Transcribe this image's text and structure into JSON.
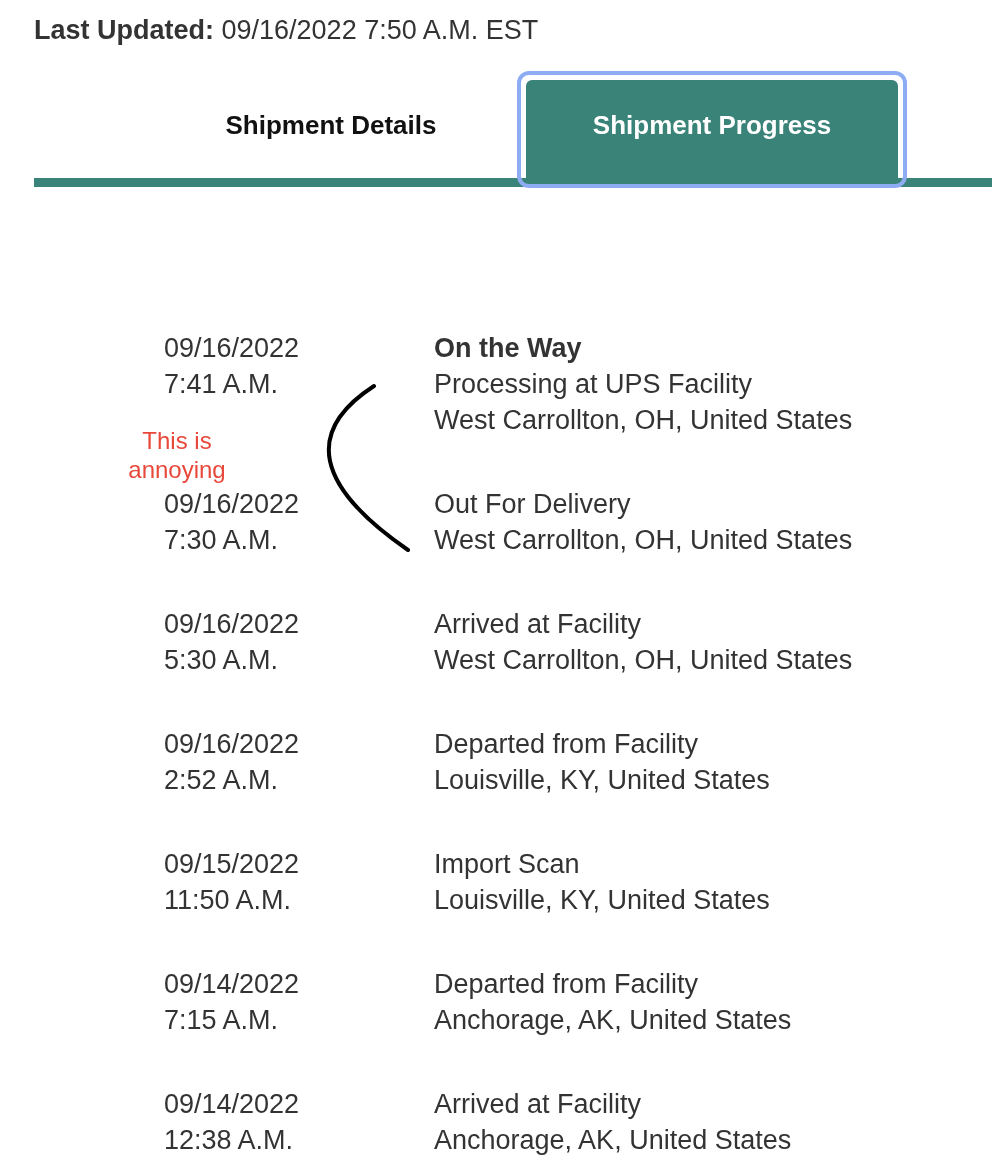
{
  "last_updated": "**Last Updated:** 09/16/2022 7:50 A.M. EST",
  "tabs": [
    {
      "label": "Shipment Details",
      "selected": false,
      "focused": false
    },
    {
      "label": "Shipment Progress",
      "selected": true,
      "focused": true
    }
  ],
  "events": [
    {
      "date": "09/16/2022",
      "time": "7:41 A.M.",
      "status": "On the Way",
      "activity": "Processing at UPS Facility",
      "location": "West Carrollton, OH, United States"
    },
    {
      "date": "09/16/2022",
      "time": "7:30 A.M.",
      "activity": "Out For Delivery",
      "location": "West Carrollton, OH, United States"
    },
    {
      "date": "09/16/2022",
      "time": "5:30 A.M.",
      "activity": "Arrived at Facility",
      "location": "West Carrollton, OH, United States"
    },
    {
      "date": "09/16/2022",
      "time": "2:52 A.M.",
      "activity": "Departed from Facility",
      "location": "Louisville, KY, United States"
    },
    {
      "date": "09/15/2022",
      "time": "11:50 A.M.",
      "activity": "Import Scan",
      "location": "Louisville, KY, United States"
    },
    {
      "date": "09/14/2022",
      "time": "7:15 A.M.",
      "activity": "Departed from Facility",
      "location": "Anchorage, AK, United States"
    },
    {
      "date": "09/14/2022",
      "time": "12:38 A.M.",
      "activity": "Arrived at Facility",
      "location": "Anchorage, AK, United States"
    }
  ],
  "annotation": {
    "text": "This is annoying"
  }
}
